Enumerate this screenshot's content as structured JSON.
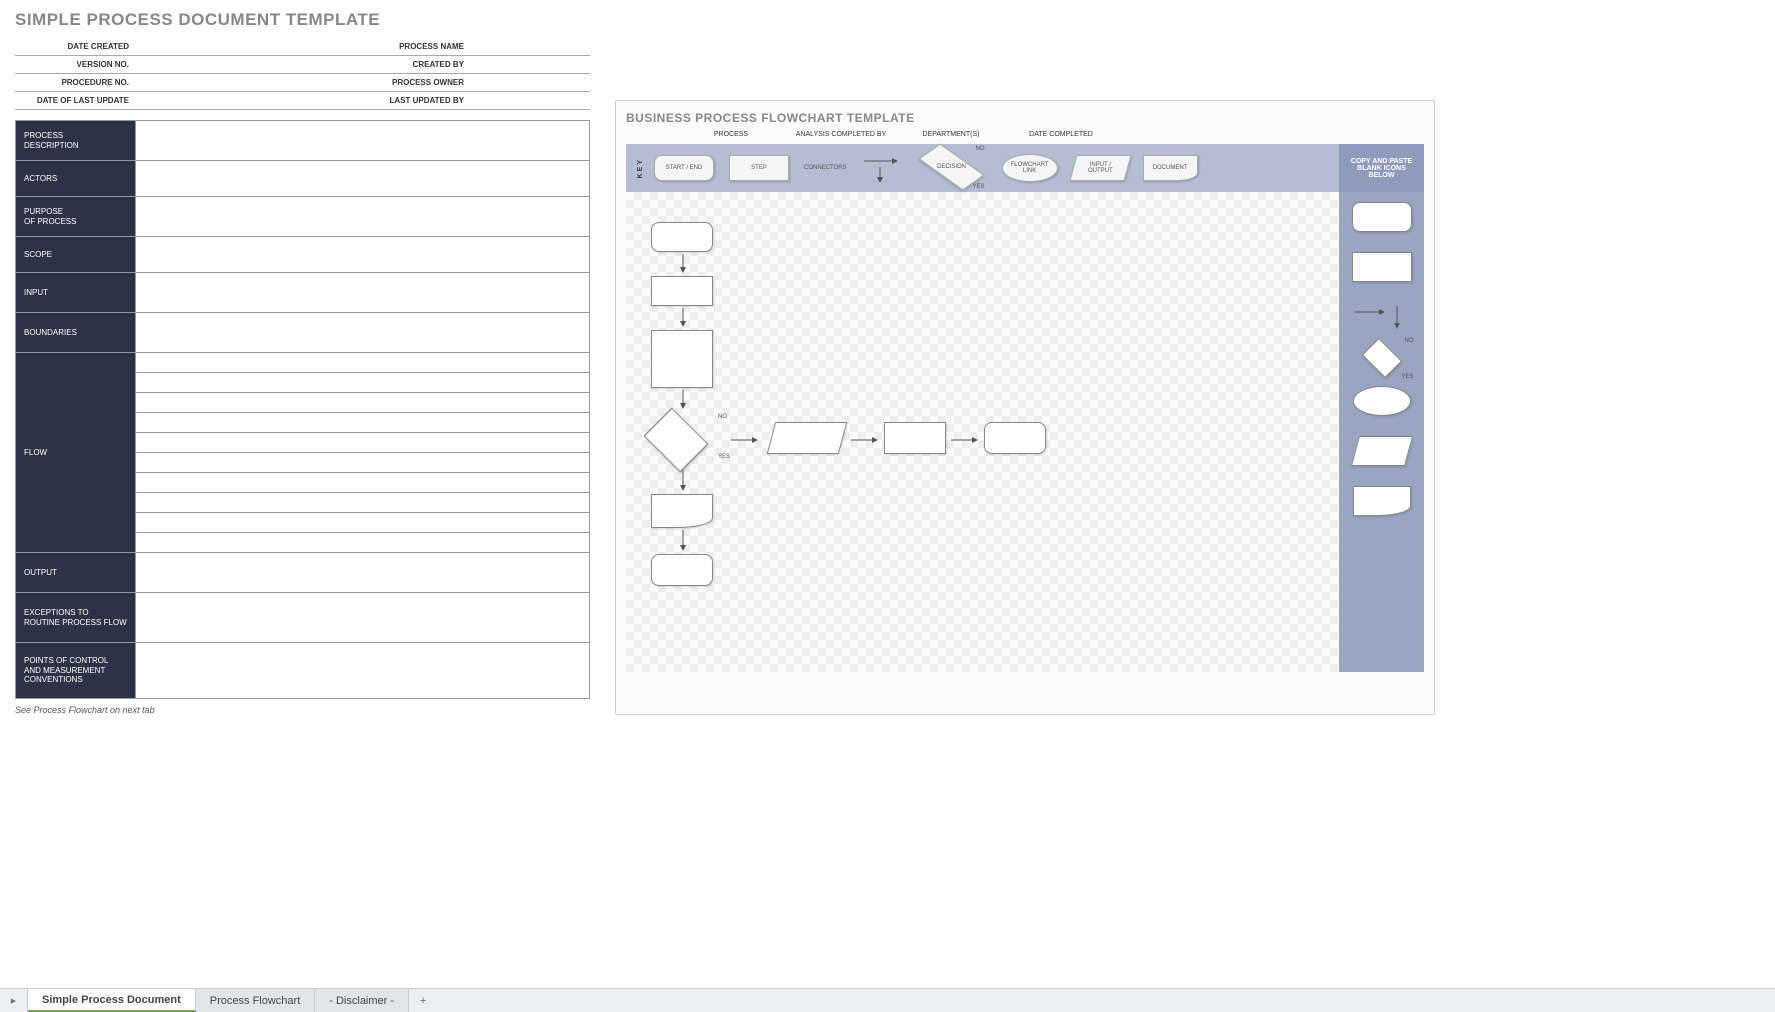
{
  "left": {
    "title": "SIMPLE PROCESS DOCUMENT TEMPLATE",
    "headers": [
      {
        "left": "DATE CREATED",
        "right": "PROCESS NAME"
      },
      {
        "left": "VERSION NO.",
        "right": "CREATED BY"
      },
      {
        "left": "PROCEDURE NO.",
        "right": "PROCESS OWNER"
      },
      {
        "left": "DATE OF LAST UPDATE",
        "right": "LAST UPDATED BY"
      }
    ],
    "sections": {
      "process_description": "PROCESS\nDESCRIPTION",
      "actors": "ACTORS",
      "purpose": "PURPOSE\nOF PROCESS",
      "scope": "SCOPE",
      "input": "INPUT",
      "boundaries": "BOUNDARIES",
      "flow": "FLOW",
      "output": "OUTPUT",
      "exceptions": "EXCEPTIONS TO\nROUTINE PROCESS FLOW",
      "points": "POINTS OF CONTROL\nAND MEASUREMENT\nCONVENTIONS"
    },
    "footnote": "See Process Flowchart on next tab"
  },
  "right": {
    "title": "BUSINESS PROCESS FLOWCHART TEMPLATE",
    "columns": [
      "PROCESS",
      "ANALYSIS COMPLETED BY",
      "DEPARTMENT(S)",
      "DATE COMPLETED"
    ],
    "key_label": "KEY",
    "key_items": {
      "start_end": "START / END",
      "step": "STEP",
      "connectors": "CONNECTORS",
      "decision": "DECISION",
      "no": "NO",
      "yes": "YES",
      "flowchart_link": "FLOWCHART\nLINK",
      "input_output": "INPUT /\nOUTPUT",
      "document": "DOCUMENT"
    },
    "copy_paste": "COPY AND PASTE\nBLANK ICONS\nBELOW"
  },
  "tabs": {
    "simple": "Simple Process Document",
    "flowchart": "Process Flowchart",
    "disclaimer": "- Disclaimer -",
    "add": "+"
  }
}
